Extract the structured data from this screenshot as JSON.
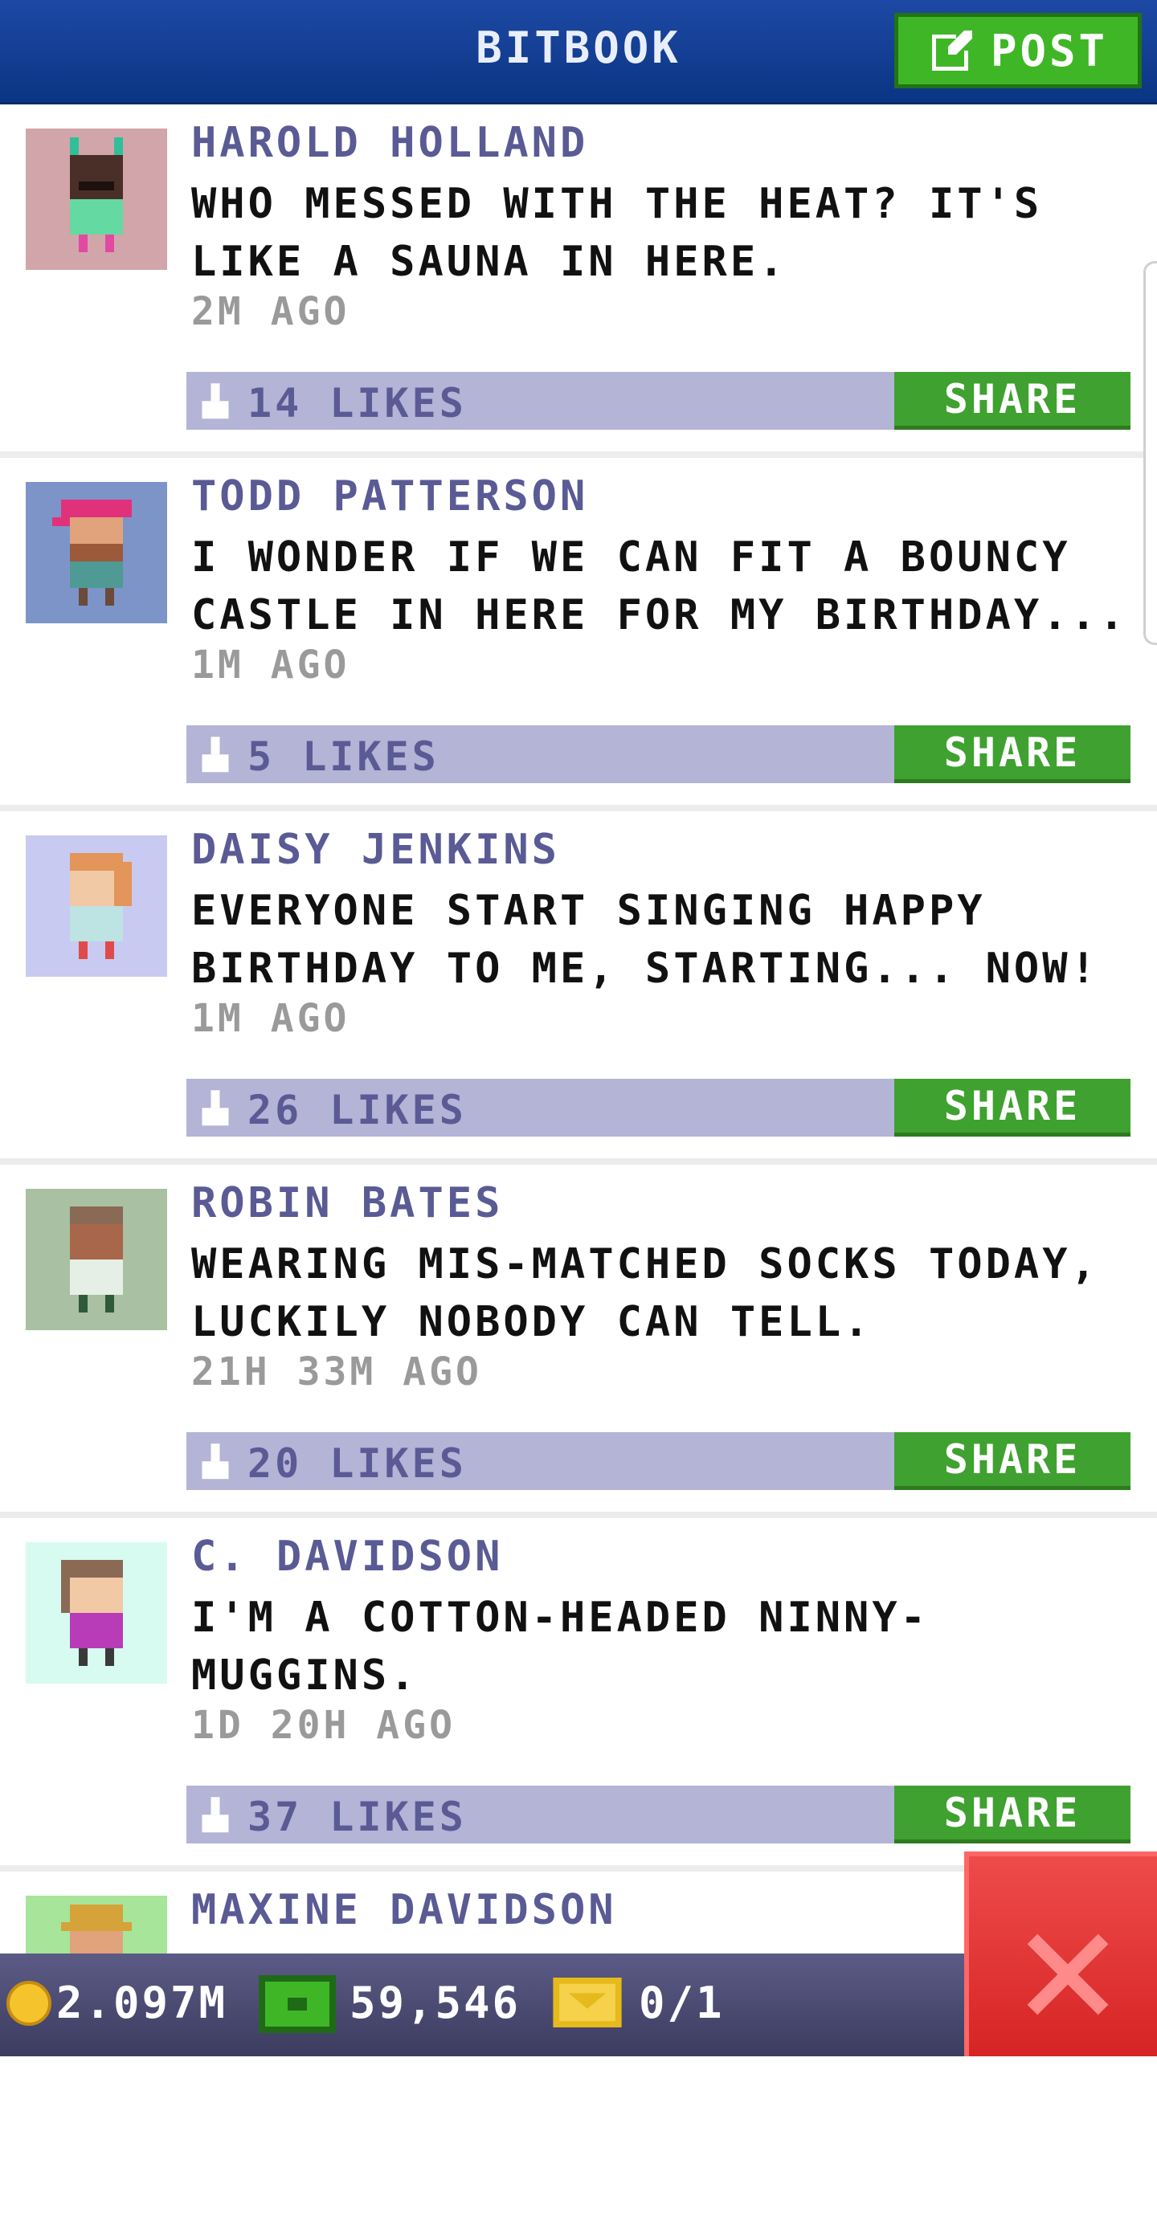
{
  "header": {
    "title": "BITBOOK",
    "post_label": "POST"
  },
  "posts": [
    {
      "author": "HAROLD HOLLAND",
      "message": "WHO MESSED WITH THE HEAT? IT'S LIKE A SAUNA IN HERE.",
      "time": "2M AGO",
      "likes": "14 LIKES",
      "share": "SHARE",
      "avatar_bg": "#d2a5aa"
    },
    {
      "author": "TODD PATTERSON",
      "message": "I WONDER IF WE CAN FIT A BOUNCY CASTLE IN HERE FOR MY BIRTHDAY...",
      "time": "1M AGO",
      "likes": "5 LIKES",
      "share": "SHARE",
      "avatar_bg": "#7d94c9"
    },
    {
      "author": "DAISY JENKINS",
      "message": "EVERYONE START SINGING HAPPY BIRTHDAY TO ME, STARTING... NOW!",
      "time": "1M AGO",
      "likes": "26 LIKES",
      "share": "SHARE",
      "avatar_bg": "#c8caf1"
    },
    {
      "author": "ROBIN BATES",
      "message": "WEARING MIS-MATCHED SOCKS TODAY, LUCKILY NOBODY CAN TELL.",
      "time": "21H 33M AGO",
      "likes": "20 LIKES",
      "share": "SHARE",
      "avatar_bg": "#a9c0a2"
    },
    {
      "author": "C. DAVIDSON",
      "message": "I'M A COTTON-HEADED NINNY-MUGGINS.",
      "time": "1D 20H AGO",
      "likes": "37 LIKES",
      "share": "SHARE",
      "avatar_bg": "#d7fbf0"
    },
    {
      "author": "MAXINE DAVIDSON",
      "message": "",
      "time": "",
      "likes": "",
      "share": "",
      "avatar_bg": "#a6e59a"
    }
  ],
  "status": {
    "coins": "2.097M",
    "bux": "59,546",
    "tickets": "0/1"
  },
  "colors": {
    "header": "#0a3584",
    "green": "#3fa12f",
    "like_bar": "#b3b4d6",
    "author": "#5a5a95",
    "close": "#d62424"
  },
  "icons": {
    "post": "edit-icon",
    "like": "thumb-up-icon",
    "coin": "coin-icon",
    "bux": "cash-icon",
    "ticket": "ticket-icon",
    "close": "close-icon"
  }
}
